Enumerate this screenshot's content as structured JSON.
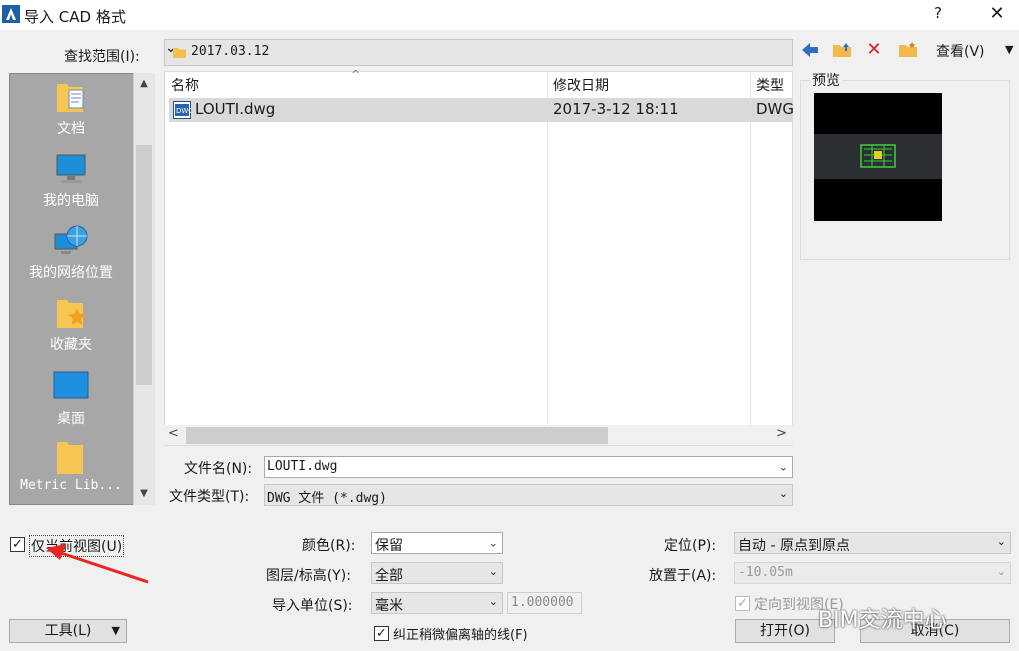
{
  "window": {
    "title": "导入 CAD 格式",
    "help": "?",
    "close": "✕"
  },
  "lookin": {
    "label": "查找范围(I):",
    "value": "2017.03.12"
  },
  "toolbar": {
    "view_label": "查看(V)"
  },
  "places": [
    {
      "label": "文档",
      "icon": "documents-folder-icon"
    },
    {
      "label": "我的电脑",
      "icon": "computer-icon"
    },
    {
      "label": "我的网络位置",
      "icon": "network-globe-icon"
    },
    {
      "label": "收藏夹",
      "icon": "favorites-folder-icon"
    },
    {
      "label": "桌面",
      "icon": "desktop-icon"
    },
    {
      "label": "Metric Lib...",
      "icon": "folder-icon"
    }
  ],
  "filelist": {
    "columns": [
      "名称",
      "修改日期",
      "类型"
    ],
    "rows": [
      {
        "name": "LOUTI.dwg",
        "date": "2017-3-12 18:11",
        "type": "DWG"
      }
    ]
  },
  "filename": {
    "label": "文件名(N):",
    "value": "LOUTI.dwg"
  },
  "filetype": {
    "label": "文件类型(T):",
    "value": "DWG 文件 (*.dwg)"
  },
  "preview": {
    "label": "预览"
  },
  "options": {
    "current_view": "仅当前视图(U)",
    "color_label": "颜色(R):",
    "color_value": "保留",
    "layers_label": "图层/标高(Y):",
    "layers_value": "全部",
    "units_label": "导入单位(S):",
    "units_value": "毫米",
    "units_factor": "1.000000",
    "correct_lines": "纠正稍微偏离轴的线(F)",
    "position_label": "定位(P):",
    "position_value": "自动 - 原点到原点",
    "place_label": "放置于(A):",
    "place_value": "-10.05m",
    "orient": "定向到视图(E)"
  },
  "buttons": {
    "tools": "工具(L)",
    "open": "打开(O)",
    "cancel": "取消(C)"
  },
  "watermark": "BIM交流中心"
}
